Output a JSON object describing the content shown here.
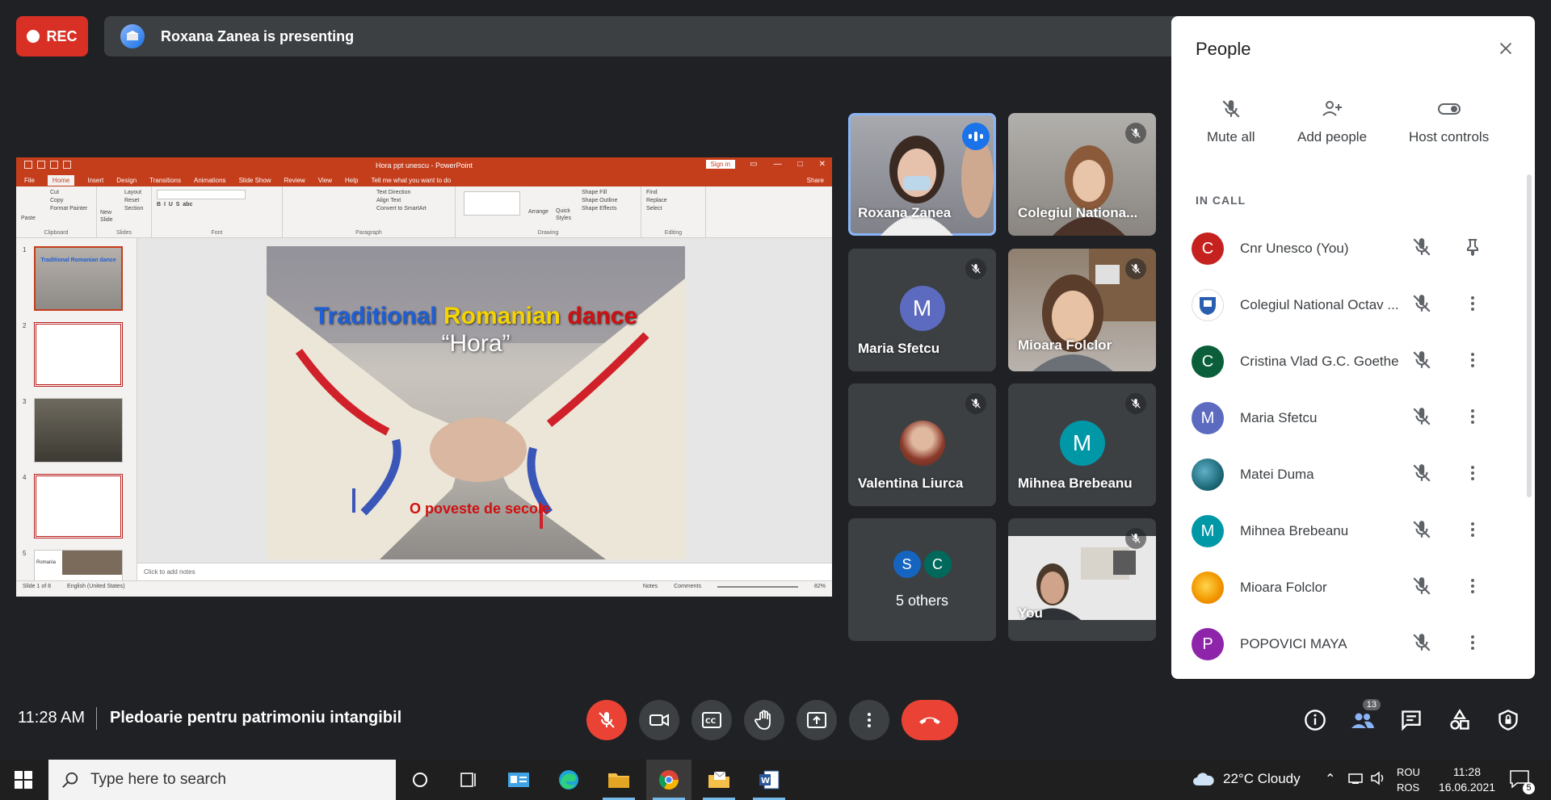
{
  "top": {
    "rec_label": "REC",
    "presenting_text": "Roxana Zanea is presenting"
  },
  "presentation": {
    "window_title": "Hora ppt unescu - PowerPoint",
    "sign_in": "Sign in",
    "tabs": [
      "File",
      "Home",
      "Insert",
      "Design",
      "Transitions",
      "Animations",
      "Slide Show",
      "Review",
      "View",
      "Help",
      "Tell me what you want to do"
    ],
    "share": "Share",
    "ribbon_groups": [
      "Clipboard",
      "Slides",
      "Font",
      "Paragraph",
      "Drawing",
      "Editing"
    ],
    "clipboard_items": [
      "Cut",
      "Copy",
      "Format Painter"
    ],
    "paste_label": "Paste",
    "slides_items": [
      "Layout",
      "Reset",
      "Section"
    ],
    "new_slide_label": "New Slide",
    "paragraph_items": [
      "Text Direction",
      "Align Text",
      "Convert to SmartArt"
    ],
    "drawing_items": [
      "Shape Fill",
      "Shape Outline",
      "Shape Effects"
    ],
    "arrange_label": "Arrange",
    "quick_styles_label": "Quick Styles",
    "editing_items": [
      "Find",
      "Replace",
      "Select"
    ],
    "slide_title_words": [
      "Traditional",
      "Romanian",
      "dance"
    ],
    "slide_title_colors": [
      "#1f5fd6",
      "#f5d300",
      "#d01010"
    ],
    "slide_subtitle": "“Hora”",
    "slide_footer": "O poveste de secole",
    "notes_placeholder": "Click to add notes",
    "status_slide": "Slide 1 of 8",
    "status_lang": "English (United States)",
    "status_notes": "Notes",
    "status_comments": "Comments",
    "zoom": "82%",
    "thumb_numbers": [
      "1",
      "2",
      "3",
      "4",
      "5"
    ],
    "thumb_title_partial": "Traditional Romanian dance",
    "thumb5_label": "Romania"
  },
  "tiles": [
    {
      "name": "Roxana Zanea",
      "speaking": true
    },
    {
      "name": "Colegiul Nationa..."
    },
    {
      "name": "Maria Sfetcu",
      "initial": "M",
      "color": "#5c6bc0"
    },
    {
      "name": "Mioara Folclor"
    },
    {
      "name": "Valentina Liurca"
    },
    {
      "name": "Mihnea Brebeanu",
      "initial": "M",
      "color": "#0097a7"
    },
    {
      "name": "5 others",
      "initials": [
        "S",
        "C"
      ],
      "colors": [
        "#1565c0",
        "#00695c"
      ]
    },
    {
      "name": "You"
    }
  ],
  "people_panel": {
    "title": "People",
    "actions": [
      "Mute all",
      "Add people",
      "Host controls"
    ],
    "section_label": "IN CALL",
    "participants": [
      {
        "name": "Cnr Unesco (You)",
        "initial": "C",
        "color": "#c5221f",
        "icon": "pin-icon"
      },
      {
        "name": "Colegiul National Octav ...",
        "initial": "",
        "color": "#ffffff",
        "icon": "more-icon"
      },
      {
        "name": "Cristina Vlad G.C. Goethe",
        "initial": "C",
        "color": "#0b5e3a",
        "icon": "more-icon"
      },
      {
        "name": "Maria Sfetcu",
        "initial": "M",
        "color": "#5c6bc0",
        "icon": "more-icon"
      },
      {
        "name": "Matei Duma",
        "initial": "",
        "color": "#1e6b7a",
        "icon": "more-icon"
      },
      {
        "name": "Mihnea Brebeanu",
        "initial": "M",
        "color": "#0097a7",
        "icon": "more-icon"
      },
      {
        "name": "Mioara Folclor",
        "initial": "",
        "color": "#f29900",
        "icon": "more-icon"
      },
      {
        "name": "POPOVICI MAYA",
        "initial": "P",
        "color": "#8e24aa",
        "icon": "more-icon"
      }
    ]
  },
  "bottom": {
    "time": "11:28 AM",
    "meeting_name": "Pledoarie pentru patrimoniu intangibil",
    "people_count": "13"
  },
  "taskbar": {
    "search_placeholder": "Type here to search",
    "weather": "22°C  Cloudy",
    "lang_top": "ROU",
    "lang_bottom": "ROS",
    "time": "11:28",
    "date": "16.06.2021",
    "notif_count": "5"
  }
}
